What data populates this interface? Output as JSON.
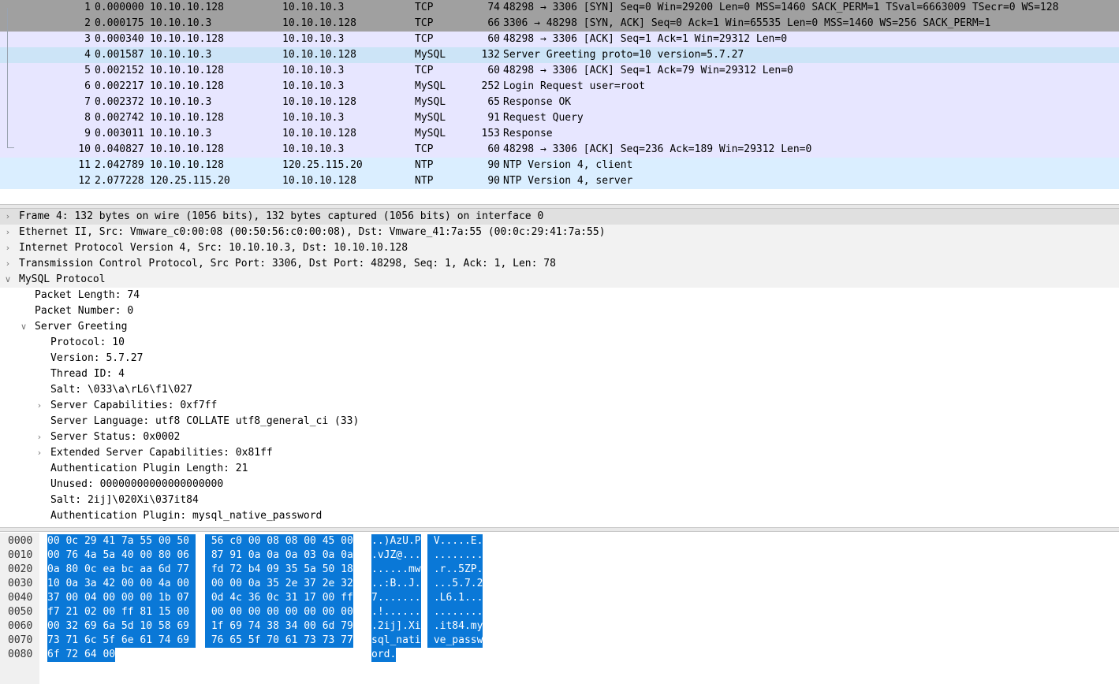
{
  "packet_list": {
    "rows": [
      {
        "no": "1",
        "time": "0.000000",
        "src": "10.10.10.128",
        "dst": "10.10.10.3",
        "proto": "TCP",
        "len": "74",
        "info": "48298 → 3306 [SYN] Seq=0 Win=29200 Len=0 MSS=1460 SACK_PERM=1 TSval=6663009 TSecr=0 WS=128",
        "bg": "#a0a0a0"
      },
      {
        "no": "2",
        "time": "0.000175",
        "src": "10.10.10.3",
        "dst": "10.10.10.128",
        "proto": "TCP",
        "len": "66",
        "info": "3306 → 48298 [SYN, ACK] Seq=0 Ack=1 Win=65535 Len=0 MSS=1460 WS=256 SACK_PERM=1",
        "bg": "#a0a0a0"
      },
      {
        "no": "3",
        "time": "0.000340",
        "src": "10.10.10.128",
        "dst": "10.10.10.3",
        "proto": "TCP",
        "len": "60",
        "info": "48298 → 3306 [ACK] Seq=1 Ack=1 Win=29312 Len=0",
        "bg": "#e7e6ff"
      },
      {
        "no": "4",
        "time": "0.001587",
        "src": "10.10.10.3",
        "dst": "10.10.10.128",
        "proto": "MySQL",
        "len": "132",
        "info": "Server Greeting proto=10 version=5.7.27",
        "bg": "#cce4f7"
      },
      {
        "no": "5",
        "time": "0.002152",
        "src": "10.10.10.128",
        "dst": "10.10.10.3",
        "proto": "TCP",
        "len": "60",
        "info": "48298 → 3306 [ACK] Seq=1 Ack=79 Win=29312 Len=0",
        "bg": "#e7e6ff"
      },
      {
        "no": "6",
        "time": "0.002217",
        "src": "10.10.10.128",
        "dst": "10.10.10.3",
        "proto": "MySQL",
        "len": "252",
        "info": "Login Request user=root",
        "bg": "#e7e6ff"
      },
      {
        "no": "7",
        "time": "0.002372",
        "src": "10.10.10.3",
        "dst": "10.10.10.128",
        "proto": "MySQL",
        "len": "65",
        "info": "Response OK",
        "bg": "#e7e6ff"
      },
      {
        "no": "8",
        "time": "0.002742",
        "src": "10.10.10.128",
        "dst": "10.10.10.3",
        "proto": "MySQL",
        "len": "91",
        "info": "Request Query",
        "bg": "#e7e6ff"
      },
      {
        "no": "9",
        "time": "0.003011",
        "src": "10.10.10.3",
        "dst": "10.10.10.128",
        "proto": "MySQL",
        "len": "153",
        "info": "Response",
        "bg": "#e7e6ff"
      },
      {
        "no": "10",
        "time": "0.040827",
        "src": "10.10.10.128",
        "dst": "10.10.10.3",
        "proto": "TCP",
        "len": "60",
        "info": "48298 → 3306 [ACK] Seq=236 Ack=189 Win=29312 Len=0",
        "bg": "#e7e6ff"
      },
      {
        "no": "11",
        "time": "2.042789",
        "src": "10.10.10.128",
        "dst": "120.25.115.20",
        "proto": "NTP",
        "len": "90",
        "info": "NTP Version 4, client",
        "bg": "#daeeff"
      },
      {
        "no": "12",
        "time": "2.077228",
        "src": "120.25.115.20",
        "dst": "10.10.10.128",
        "proto": "NTP",
        "len": "90",
        "info": "NTP Version 4, server",
        "bg": "#daeeff"
      }
    ]
  },
  "detail_tree": {
    "rows": [
      {
        "text": "Frame 4: 132 bytes on wire (1056 bits), 132 bytes captured (1056 bits) on interface 0",
        "level": 0,
        "expander": "collapsed",
        "bg": "#e0e0e0"
      },
      {
        "text": "Ethernet II, Src: Vmware_c0:00:08 (00:50:56:c0:00:08), Dst: Vmware_41:7a:55 (00:0c:29:41:7a:55)",
        "level": 0,
        "expander": "collapsed",
        "bg": "#f2f2f2"
      },
      {
        "text": "Internet Protocol Version 4, Src: 10.10.10.3, Dst: 10.10.10.128",
        "level": 0,
        "expander": "collapsed",
        "bg": "#f2f2f2"
      },
      {
        "text": "Transmission Control Protocol, Src Port: 3306, Dst Port: 48298, Seq: 1, Ack: 1, Len: 78",
        "level": 0,
        "expander": "collapsed",
        "bg": "#f2f2f2"
      },
      {
        "text": "MySQL Protocol",
        "level": 0,
        "expander": "expanded",
        "bg": "#f2f2f2"
      },
      {
        "text": "Packet Length: 74",
        "level": 1,
        "expander": "none",
        "bg": "#ffffff"
      },
      {
        "text": "Packet Number: 0",
        "level": 1,
        "expander": "none",
        "bg": "#ffffff"
      },
      {
        "text": "Server Greeting",
        "level": 1,
        "expander": "expanded",
        "bg": "#ffffff"
      },
      {
        "text": "Protocol: 10",
        "level": 2,
        "expander": "none",
        "bg": "#ffffff"
      },
      {
        "text": "Version: 5.7.27",
        "level": 2,
        "expander": "none",
        "bg": "#ffffff"
      },
      {
        "text": "Thread ID: 4",
        "level": 2,
        "expander": "none",
        "bg": "#ffffff"
      },
      {
        "text": "Salt: \\033\\a\\rL6\\f1\\027",
        "level": 2,
        "expander": "none",
        "bg": "#ffffff"
      },
      {
        "text": "Server Capabilities: 0xf7ff",
        "level": 2,
        "expander": "collapsed",
        "bg": "#ffffff"
      },
      {
        "text": "Server Language: utf8 COLLATE utf8_general_ci (33)",
        "level": 2,
        "expander": "none",
        "bg": "#ffffff"
      },
      {
        "text": "Server Status: 0x0002",
        "level": 2,
        "expander": "collapsed",
        "bg": "#ffffff"
      },
      {
        "text": "Extended Server Capabilities: 0x81ff",
        "level": 2,
        "expander": "collapsed",
        "bg": "#ffffff"
      },
      {
        "text": "Authentication Plugin Length: 21",
        "level": 2,
        "expander": "none",
        "bg": "#ffffff"
      },
      {
        "text": "Unused: 00000000000000000000",
        "level": 2,
        "expander": "none",
        "bg": "#ffffff"
      },
      {
        "text": "Salt: 2ij]\\020Xi\\037it84",
        "level": 2,
        "expander": "none",
        "bg": "#ffffff"
      },
      {
        "text": "Authentication Plugin: mysql_native_password",
        "level": 2,
        "expander": "none",
        "bg": "#ffffff"
      }
    ]
  },
  "bytes_pane": {
    "rows": [
      {
        "offset": "0000",
        "hex1": "00 0c 29 41 7a 55 00 50 ",
        "hex2": " 56 c0 00 08 08 00 45 00",
        "asc1": "..)AzU.P",
        "asc2": " V.....E."
      },
      {
        "offset": "0010",
        "hex1": "00 76 4a 5a 40 00 80 06 ",
        "hex2": " 87 91 0a 0a 0a 03 0a 0a",
        "asc1": ".vJZ@...",
        "asc2": " ........"
      },
      {
        "offset": "0020",
        "hex1": "0a 80 0c ea bc aa 6d 77 ",
        "hex2": " fd 72 b4 09 35 5a 50 18",
        "asc1": "......mw",
        "asc2": " .r..5ZP."
      },
      {
        "offset": "0030",
        "hex1": "10 0a 3a 42 00 00 4a 00 ",
        "hex2": " 00 00 0a 35 2e 37 2e 32",
        "asc1": "..:B..J.",
        "asc2": " ...5.7.2"
      },
      {
        "offset": "0040",
        "hex1": "37 00 04 00 00 00 1b 07 ",
        "hex2": " 0d 4c 36 0c 31 17 00 ff",
        "asc1": "7.......",
        "asc2": " .L6.1..."
      },
      {
        "offset": "0050",
        "hex1": "f7 21 02 00 ff 81 15 00 ",
        "hex2": " 00 00 00 00 00 00 00 00",
        "asc1": ".!......",
        "asc2": " ........"
      },
      {
        "offset": "0060",
        "hex1": "00 32 69 6a 5d 10 58 69 ",
        "hex2": " 1f 69 74 38 34 00 6d 79",
        "asc1": ".2ij].Xi",
        "asc2": " .it84.my"
      },
      {
        "offset": "0070",
        "hex1": "73 71 6c 5f 6e 61 74 69 ",
        "hex2": " 76 65 5f 70 61 73 73 77",
        "asc1": "sql_nati",
        "asc2": " ve_passw"
      },
      {
        "offset": "0080",
        "hex1": "6f 72 64 00",
        "hex2": "",
        "asc1": "ord.",
        "asc2": ""
      }
    ]
  },
  "colors": {
    "selection": "#0a78d7",
    "tcp_syn": "#a0a0a0",
    "tcp": "#e7e6ff",
    "ntp": "#daeeff",
    "selected_row": "#cce4f7"
  }
}
